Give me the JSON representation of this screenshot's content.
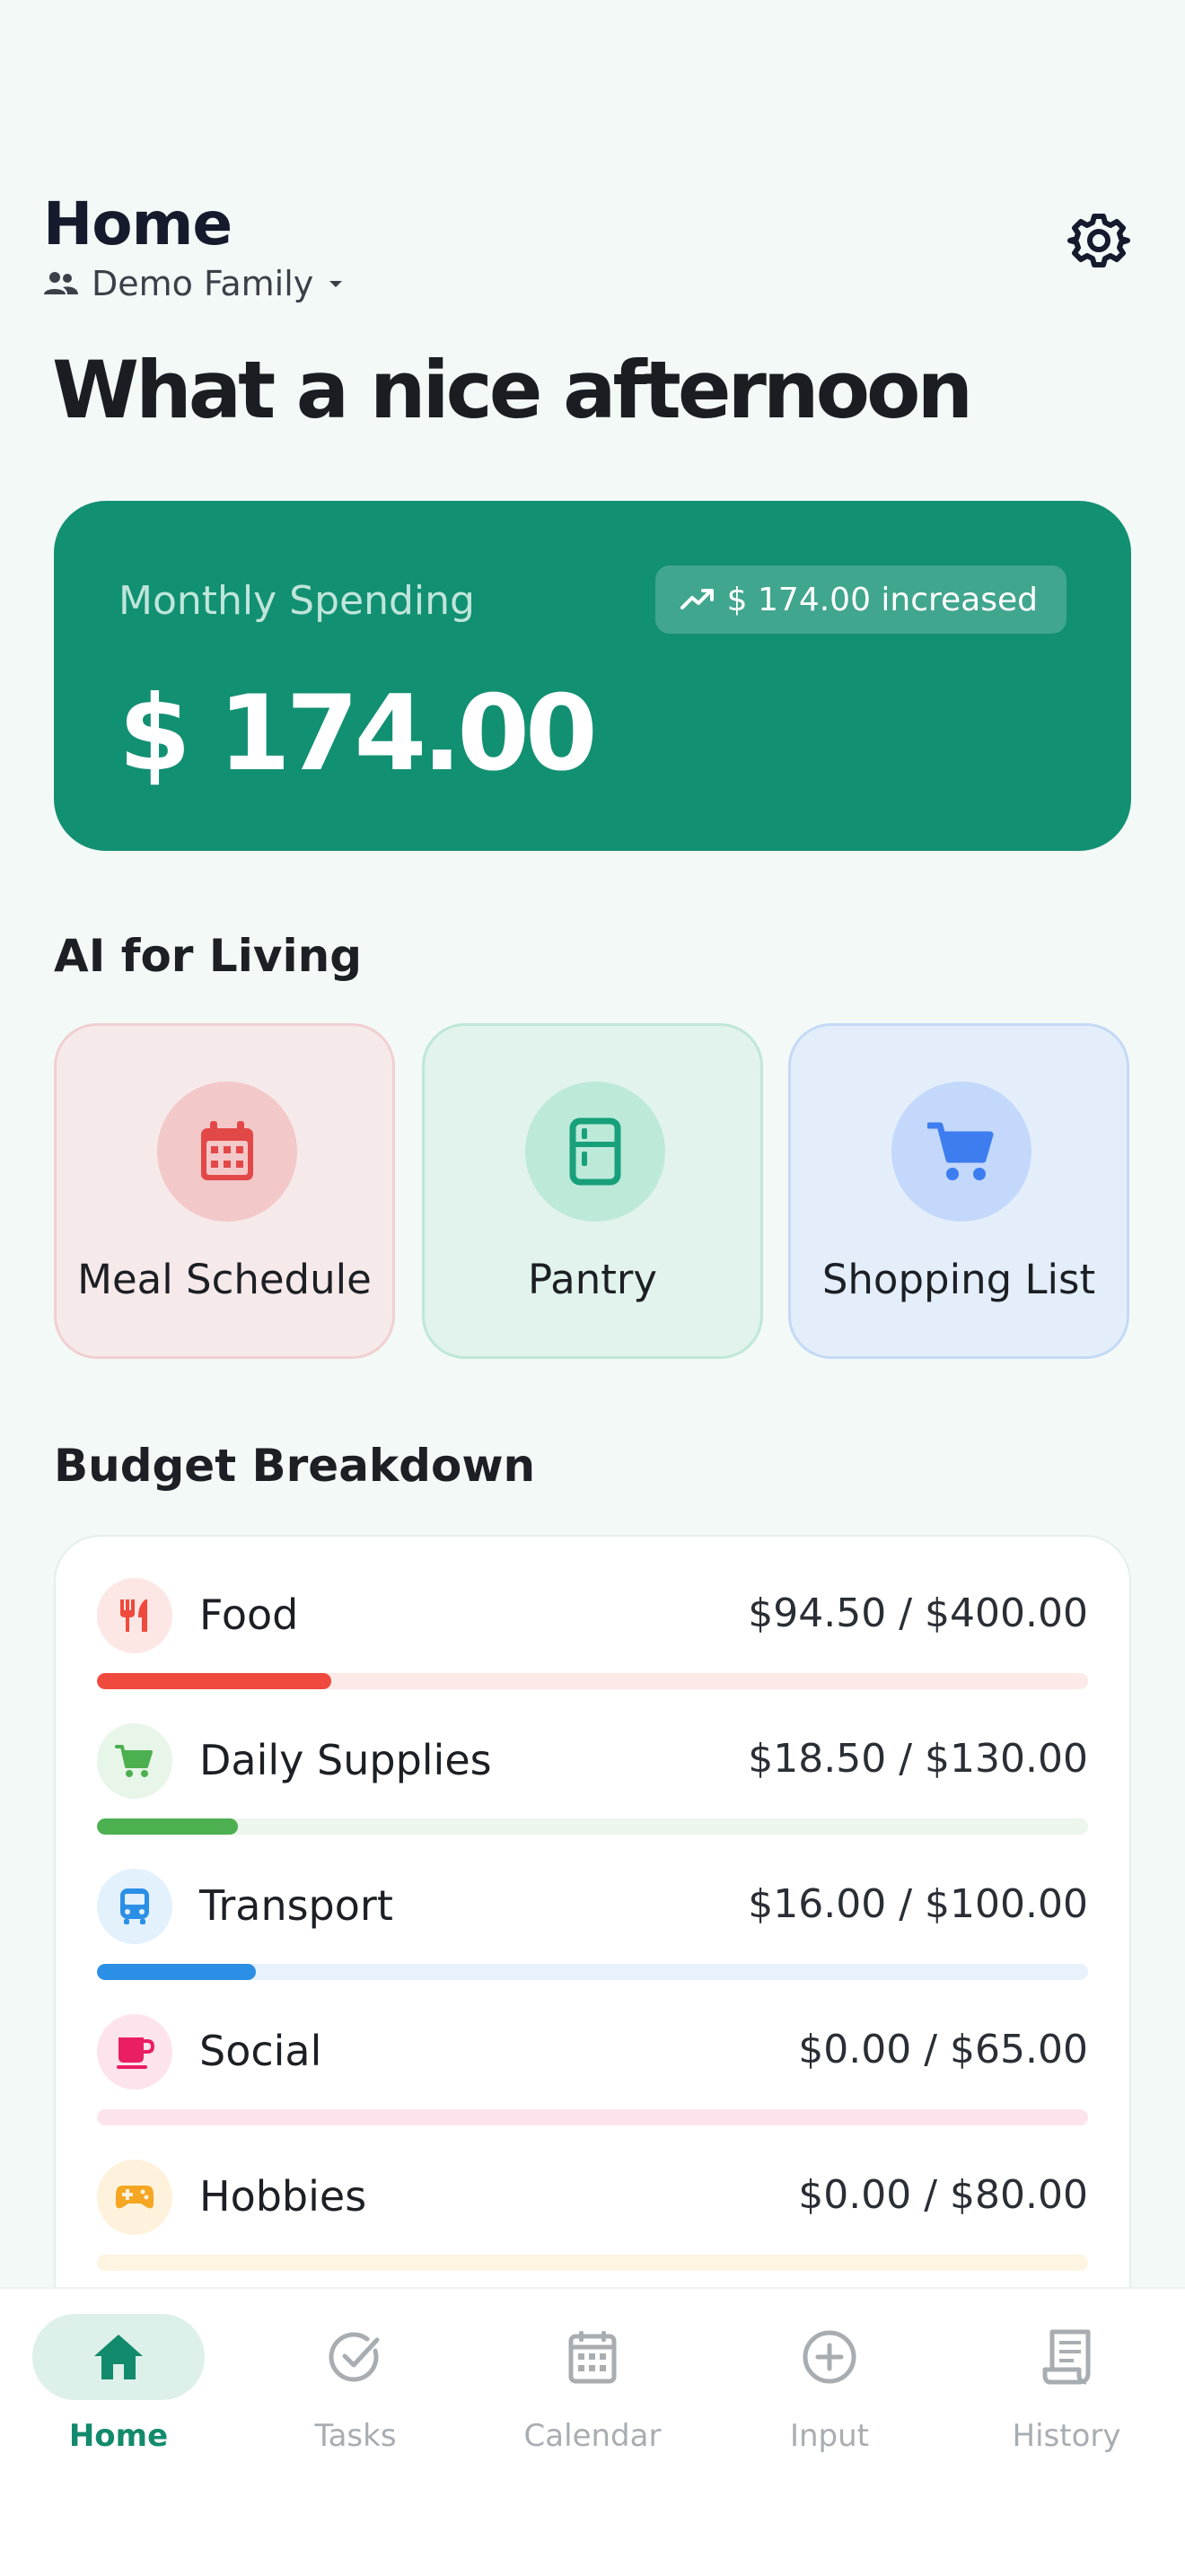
{
  "header": {
    "title": "Home",
    "family_name": "Demo Family",
    "greeting": "What a nice afternoon"
  },
  "spending": {
    "label": "Monthly Spending",
    "badge": "$ 174.00 increased",
    "amount": "$ 174.00"
  },
  "ai_section": {
    "title": "AI for Living",
    "cards": [
      {
        "label": "Meal Schedule",
        "icon": "calendar-icon",
        "color": "#e34848"
      },
      {
        "label": "Pantry",
        "icon": "fridge-icon",
        "color": "#17a07a"
      },
      {
        "label": "Shopping List",
        "icon": "cart-icon",
        "color": "#3d7df0"
      }
    ]
  },
  "budget": {
    "title": "Budget Breakdown",
    "items": [
      {
        "name": "Food",
        "amount": "$94.50 / $400.00",
        "spent": 94.5,
        "limit": 400,
        "color": "#f0493e",
        "icon": "fork-knife-icon"
      },
      {
        "name": "Daily Supplies",
        "amount": "$18.50 / $130.00",
        "spent": 18.5,
        "limit": 130,
        "color": "#4caf50",
        "icon": "cart-icon"
      },
      {
        "name": "Transport",
        "amount": "$16.00 / $100.00",
        "spent": 16,
        "limit": 100,
        "color": "#2b8fe6",
        "icon": "bus-icon"
      },
      {
        "name": "Social",
        "amount": "$0.00 / $65.00",
        "spent": 0,
        "limit": 65,
        "color": "#e91e63",
        "icon": "coffee-cup-icon"
      },
      {
        "name": "Hobbies",
        "amount": "$0.00 / $80.00",
        "spent": 0,
        "limit": 80,
        "color": "#f5a623",
        "icon": "gamepad-icon"
      }
    ]
  },
  "nav": {
    "items": [
      {
        "label": "Home",
        "icon": "home-icon",
        "active": true
      },
      {
        "label": "Tasks",
        "icon": "check-circle-icon",
        "active": false
      },
      {
        "label": "Calendar",
        "icon": "calendar-icon",
        "active": false
      },
      {
        "label": "Input",
        "icon": "plus-circle-icon",
        "active": false
      },
      {
        "label": "History",
        "icon": "receipt-icon",
        "active": false
      }
    ]
  }
}
